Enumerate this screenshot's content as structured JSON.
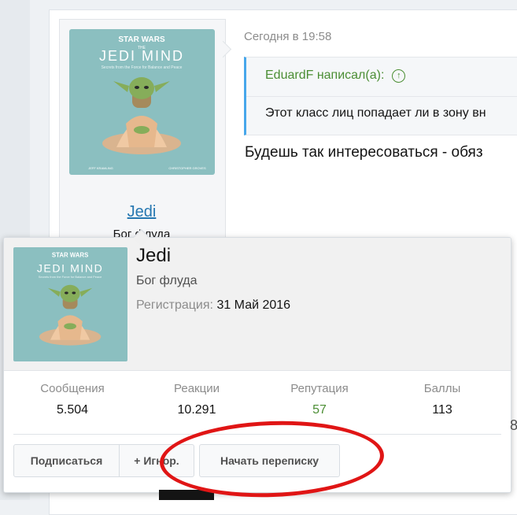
{
  "post": {
    "username": "Jedi",
    "user_title": "Бог флуда",
    "date": "Сегодня в 19:58",
    "quote": {
      "author": "EduardF написал(а):",
      "text": "Этот класс лиц попадает ли в зону вн"
    },
    "message": "Будешь так интересоваться - обяз"
  },
  "avatar": {
    "brand": "STAR WARS",
    "book_kicker": "THE",
    "book_title": "JEDI MIND",
    "book_subtitle": "Secrets from the Force for Balance and Peace",
    "author_left": "JEFF KRAMLING",
    "author_right": "CHRISTOPHER GROVES"
  },
  "tooltip": {
    "name": "Jedi",
    "title": "Бог флуда",
    "reg_label": "Регистрация:",
    "reg_value": "31 Май 2016",
    "stats": [
      {
        "label": "Сообщения",
        "value": "5.504"
      },
      {
        "label": "Реакции",
        "value": "10.291"
      },
      {
        "label": "Репутация",
        "value": "57"
      },
      {
        "label": "Баллы",
        "value": "113"
      }
    ],
    "buttons": {
      "follow": "Подписаться",
      "ignore": "+ Игнор.",
      "message": "Начать переписку"
    }
  },
  "peek_text": "8",
  "colors": {
    "link": "#2577b1",
    "quote_author": "#4b8e34",
    "annotation": "#e01515",
    "avatar_bg": "#8bbfc0"
  }
}
